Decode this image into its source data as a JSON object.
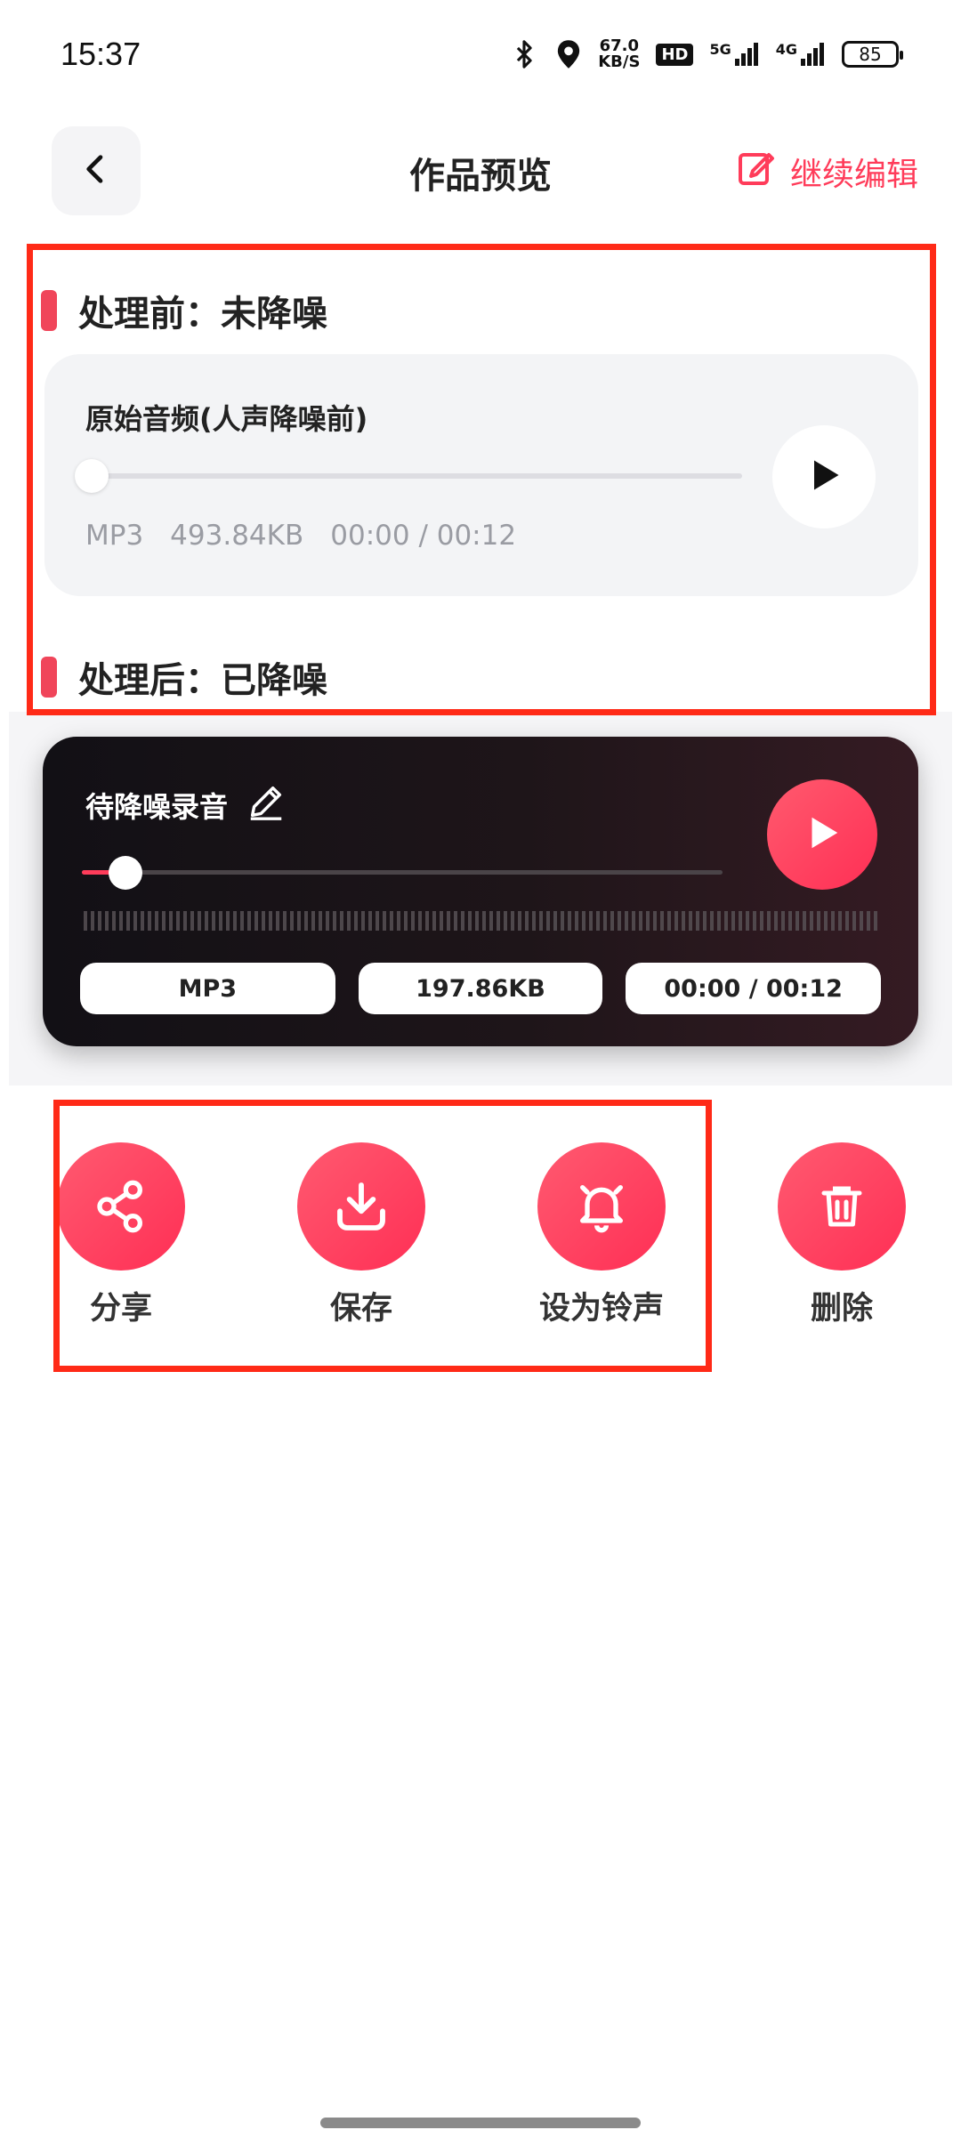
{
  "status_bar": {
    "time": "15:37",
    "net_speed_value": "67.0",
    "net_speed_unit": "KB/S",
    "hd_label": "HD",
    "sig1_label": "5G",
    "sig2_label": "4G",
    "battery": "85",
    "icons": [
      "bluetooth-icon",
      "location-icon",
      "signal-icon",
      "battery-icon"
    ]
  },
  "header": {
    "back_icon": "chevron-left-icon",
    "title": "作品预览",
    "edit_label": "继续编辑",
    "edit_icon": "edit-icon"
  },
  "before": {
    "section_title": "处理前：未降噪",
    "file_name": "原始音频(人声降噪前)",
    "format": "MP3",
    "size": "493.84KB",
    "time": "00:00 / 00:12",
    "progress": 0
  },
  "after": {
    "section_title": "处理后：已降噪",
    "file_name": "待降噪录音",
    "format": "MP3",
    "size": "197.86KB",
    "time": "00:00 / 00:12",
    "progress": 0
  },
  "actions": [
    {
      "label": "分享",
      "icon": "share-icon"
    },
    {
      "label": "保存",
      "icon": "download-icon"
    },
    {
      "label": "设为铃声",
      "icon": "bell-icon"
    },
    {
      "label": "删除",
      "icon": "trash-icon"
    }
  ],
  "colors": {
    "accent": "#ff3c5a",
    "highlight": "#ff2a17",
    "dark_card": "#121015"
  }
}
